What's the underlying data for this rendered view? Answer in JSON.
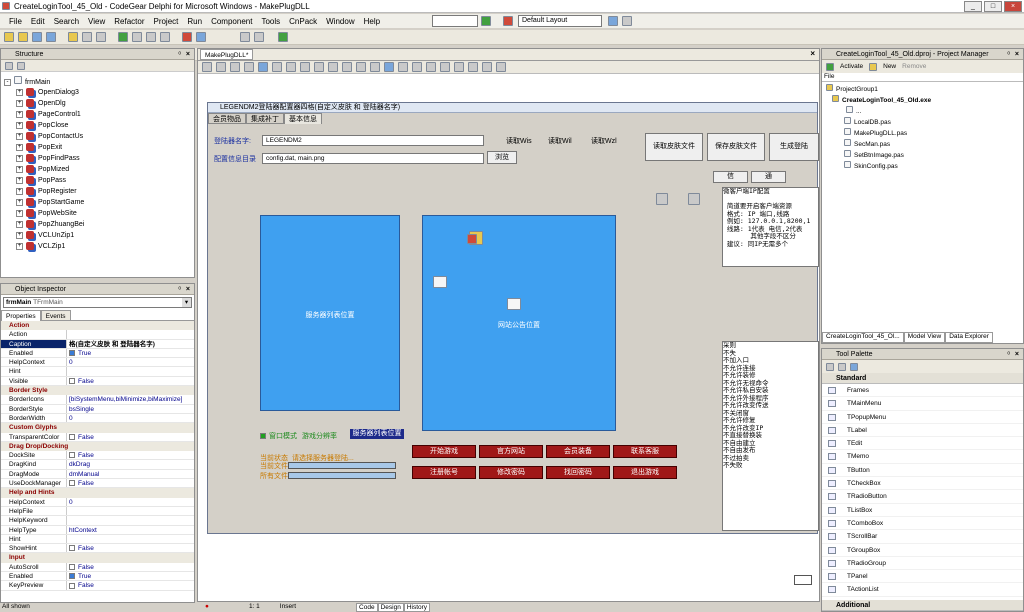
{
  "window": {
    "title": "CreateLoginTool_45_Old - CodeGear Delphi for Microsoft Windows - MakePlugDLL"
  },
  "menu": [
    "File",
    "Edit",
    "Search",
    "View",
    "Refactor",
    "Project",
    "Run",
    "Component",
    "Tools",
    "CnPack",
    "Window",
    "Help"
  ],
  "layout_combo": "Default Layout",
  "structure": {
    "title": "Structure",
    "root": "frmMain",
    "items": [
      "OpenDialog3",
      "OpenDlg",
      "PageControl1",
      "PopClose",
      "PopContactUs",
      "PopExit",
      "PopFindPass",
      "PopMized",
      "PopPass",
      "PopRegister",
      "PopStartGame",
      "PopWebSite",
      "PopZhuangBei",
      "VCLUnZip1",
      "VCLZip1"
    ]
  },
  "inspector": {
    "title": "Object Inspector",
    "object": "frmMain",
    "object_type": "TFrmMain",
    "tabs": [
      "Properties",
      "Events"
    ],
    "rows": [
      {
        "cat": "Action"
      },
      {
        "k": "Action",
        "v": ""
      },
      {
        "k": "Caption",
        "v": "格(自定义皮肤 和 登陆器名字)"
      },
      {
        "k": "Enabled",
        "v": "True",
        "cb": true
      },
      {
        "k": "HelpContext",
        "v": "0"
      },
      {
        "k": "Hint",
        "v": ""
      },
      {
        "k": "Visible",
        "v": "False",
        "cb": false
      },
      {
        "cat": "Border Style"
      },
      {
        "k": "BorderIcons",
        "v": "[biSystemMenu,biMinimize,biMaximize]"
      },
      {
        "k": "BorderStyle",
        "v": "bsSingle"
      },
      {
        "k": "BorderWidth",
        "v": "0"
      },
      {
        "cat": "Custom Glyphs"
      },
      {
        "k": "TransparentColor",
        "v": "False",
        "cb": false
      },
      {
        "cat": "Drag Drop/Docking"
      },
      {
        "k": "DockSite",
        "v": "False",
        "cb": false
      },
      {
        "k": "DragKind",
        "v": "dkDrag"
      },
      {
        "k": "DragMode",
        "v": "dmManual"
      },
      {
        "k": "UseDockManager",
        "v": "False",
        "cb": false
      },
      {
        "cat": "Help and Hints"
      },
      {
        "k": "HelpContext",
        "v": "0"
      },
      {
        "k": "HelpFile",
        "v": ""
      },
      {
        "k": "HelpKeyword",
        "v": ""
      },
      {
        "k": "HelpType",
        "v": "htContext"
      },
      {
        "k": "Hint",
        "v": ""
      },
      {
        "k": "ShowHint",
        "v": "False",
        "cb": false
      },
      {
        "cat": "Input"
      },
      {
        "k": "AutoScroll",
        "v": "False",
        "cb": false
      },
      {
        "k": "Enabled",
        "v": "True",
        "cb": true
      },
      {
        "k": "KeyPreview",
        "v": "False",
        "cb": false
      }
    ],
    "footer": "All shown"
  },
  "editor": {
    "tab": "MakePlugDLL*",
    "bottom_tabs": [
      "Code",
      "Design",
      "History"
    ],
    "position": "1:  1",
    "mode": "Insert"
  },
  "form": {
    "title": "LEGENDM2登陆器配置器四格(自定义皮肤 和 登陆器名字)",
    "tabs": [
      "会员物品",
      "集成补丁",
      "基本信息"
    ],
    "label_name": "登陆器名字:",
    "name_value": "LEGENDM2",
    "label_dir": "配置信息目录",
    "dir_value": "config.dat, main.png",
    "browse": "浏览",
    "read_wis": "读取Wis",
    "read_wil": "读取Wil",
    "read_wzl": "读取Wzl",
    "read_skin": "读取皮肤文件",
    "save_skin": "保存皮肤文件",
    "gen_login": "生成登陆",
    "info": "信",
    "comm": "通",
    "server_panel": "服务器列表位置",
    "news_panel": "网站公告位置",
    "window_mode": "窗口模式",
    "game_opts": "游戏分辨率",
    "server_list_pos": "服务器列表位置",
    "status_label": "当前状态",
    "status_text": "请选择服务器登陆...",
    "current_file": "当前文件",
    "all_files": "所有文件",
    "red_buttons": [
      "开始游戏",
      "官方网站",
      "会员装备",
      "联系客服",
      "注册帐号",
      "修改密码",
      "找回密码",
      "退出游戏"
    ],
    "memo1": "微客户端IP配置\n\n 简道要开启客户端资源 \n 格式: IP 端口,线路\n 例如: 127.0.0.1,8200,1\n 线路: 1代表 电信,2代表\n       其他字段不区分\n 建议: 同IP无需多个\n\n",
    "memo2": "采则\n不失\n不加入口\n不允许连接\n不允许装修\n不允许无视命令\n不允许私自安装\n不允许外接程序\n不允许改变传送\n不关闭窗\n不允许修复\n不允许改变IP\n不直接替换装\n不自由建立\n不自由发布\n不过拍卖\n不失败"
  },
  "project": {
    "title": "CreateLoginTool_45_Old.dproj - Project Manager",
    "activate": "Activate",
    "new": "New",
    "remove": "Remove",
    "file_col": "File",
    "items": [
      "ProjectGroup1",
      "CreateLoginTool_45_Old.exe",
      "...",
      "LocalDB.pas",
      "MakePlugDLL.pas",
      "SecMan.pas",
      "SetBtnImage.pas",
      "SkinConfig.pas"
    ],
    "tabs": [
      "CreateLoginTool_45_Ol...",
      "Model View",
      "Data Explorer"
    ]
  },
  "palette": {
    "title": "Tool Palette",
    "category": "Standard",
    "category2": "Additional",
    "items": [
      "Frames",
      "TMainMenu",
      "TPopupMenu",
      "TLabel",
      "TEdit",
      "TMemo",
      "TButton",
      "TCheckBox",
      "TRadioButton",
      "TListBox",
      "TComboBox",
      "TScrollBar",
      "TGroupBox",
      "TRadioGroup",
      "TPanel",
      "TActionList"
    ]
  }
}
